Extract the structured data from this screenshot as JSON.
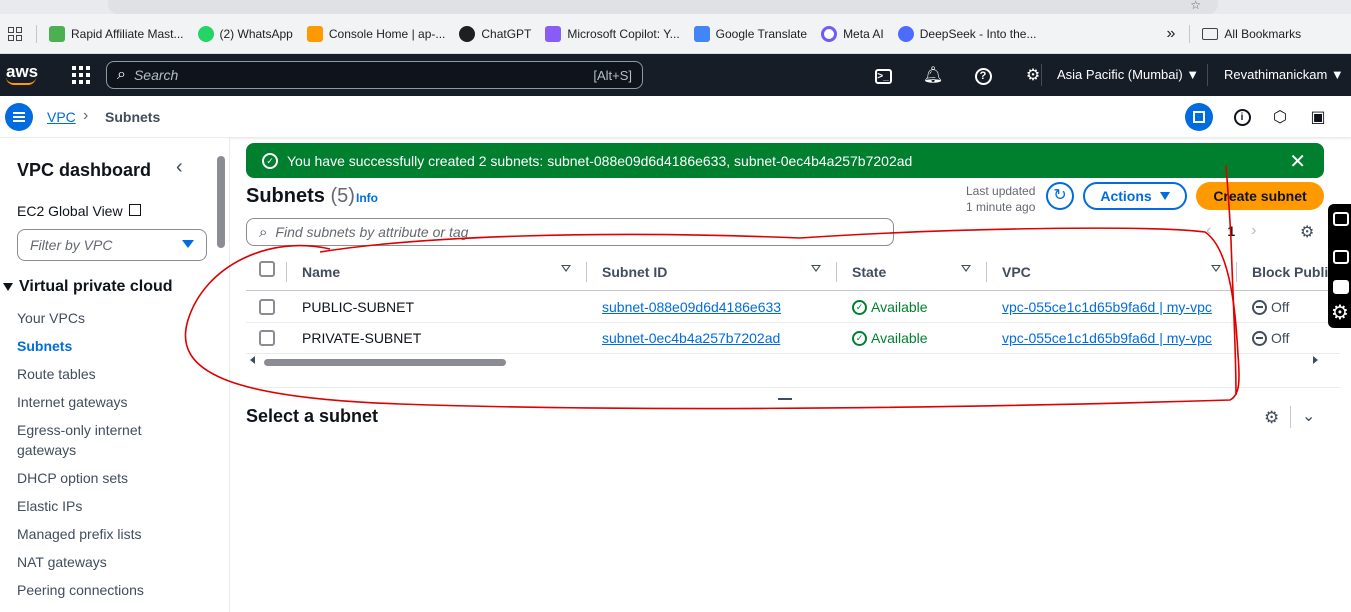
{
  "browser": {
    "bookmarks": [
      {
        "label": "Rapid Affiliate Mast...",
        "icon": "rapid-affiliate-favicon",
        "color": "#4caf50"
      },
      {
        "label": "(2) WhatsApp",
        "icon": "whatsapp-favicon",
        "color": "#25d366"
      },
      {
        "label": "Console Home | ap-...",
        "icon": "aws-console-favicon",
        "color": "#ff9900"
      },
      {
        "label": "ChatGPT",
        "icon": "chatgpt-favicon",
        "color": "#1f1f1f"
      },
      {
        "label": "Microsoft Copilot: Y...",
        "icon": "copilot-favicon",
        "color": "#8a5cf6"
      },
      {
        "label": "Google Translate",
        "icon": "google-translate-favicon",
        "color": "#4285f4"
      },
      {
        "label": "Meta AI",
        "icon": "meta-ai-favicon",
        "color": "#6e5cf6"
      },
      {
        "label": "DeepSeek - Into the...",
        "icon": "deepseek-favicon",
        "color": "#4d6bfe"
      }
    ],
    "more_bookmarks": "»",
    "all_bookmarks": "All Bookmarks"
  },
  "topnav": {
    "logo": "aws",
    "search_placeholder": "Search",
    "search_shortcut": "[Alt+S]",
    "region": "Asia Pacific (Mumbai) ▼",
    "user": "Revathimanickam ▼"
  },
  "breadcrumb": {
    "parent": "VPC",
    "current": "Subnets"
  },
  "sidebar": {
    "title": "VPC dashboard",
    "ec2_global_view": "EC2 Global View",
    "filter_placeholder": "Filter by VPC",
    "section": "Virtual private cloud",
    "items": [
      {
        "label": "Your VPCs",
        "active": false
      },
      {
        "label": "Subnets",
        "active": true
      },
      {
        "label": "Route tables",
        "active": false
      },
      {
        "label": "Internet gateways",
        "active": false
      },
      {
        "label": "Egress-only internet gateways",
        "active": false
      },
      {
        "label": "DHCP option sets",
        "active": false
      },
      {
        "label": "Elastic IPs",
        "active": false
      },
      {
        "label": "Managed prefix lists",
        "active": false
      },
      {
        "label": "NAT gateways",
        "active": false
      },
      {
        "label": "Peering connections",
        "active": false
      }
    ]
  },
  "flash": {
    "message": "You have successfully created 2 subnets: subnet-088e09d6d4186e633, subnet-0ec4b4a257b7202ad",
    "color": "#00802f"
  },
  "header": {
    "title": "Subnets",
    "count": "(5)",
    "info": "Info",
    "last_updated_line1": "Last updated",
    "last_updated_line2": "1 minute ago",
    "actions_label": "Actions",
    "create_label": "Create subnet"
  },
  "filter": {
    "placeholder": "Find subnets by attribute or tag"
  },
  "pagination": {
    "page": "1"
  },
  "table": {
    "columns": [
      "Name",
      "Subnet ID",
      "State",
      "VPC",
      "Block Publi"
    ],
    "rows": [
      {
        "name": "PUBLIC-SUBNET",
        "subnet_id": "subnet-088e09d6d4186e633",
        "state": "Available",
        "vpc": "vpc-055ce1c1d65b9fa6d | my-vpc",
        "block_public": "Off"
      },
      {
        "name": "PRIVATE-SUBNET",
        "subnet_id": "subnet-0ec4b4a257b7202ad",
        "state": "Available",
        "vpc": "vpc-055ce1c1d65b9fa6d | my-vpc",
        "block_public": "Off"
      }
    ]
  },
  "detail": {
    "title": "Select a subnet"
  },
  "colors": {
    "accent": "#006ce0",
    "success": "#00802f",
    "primary_button": "#ff9900",
    "nav_bg": "#161d26",
    "annotation": "#e00000"
  }
}
